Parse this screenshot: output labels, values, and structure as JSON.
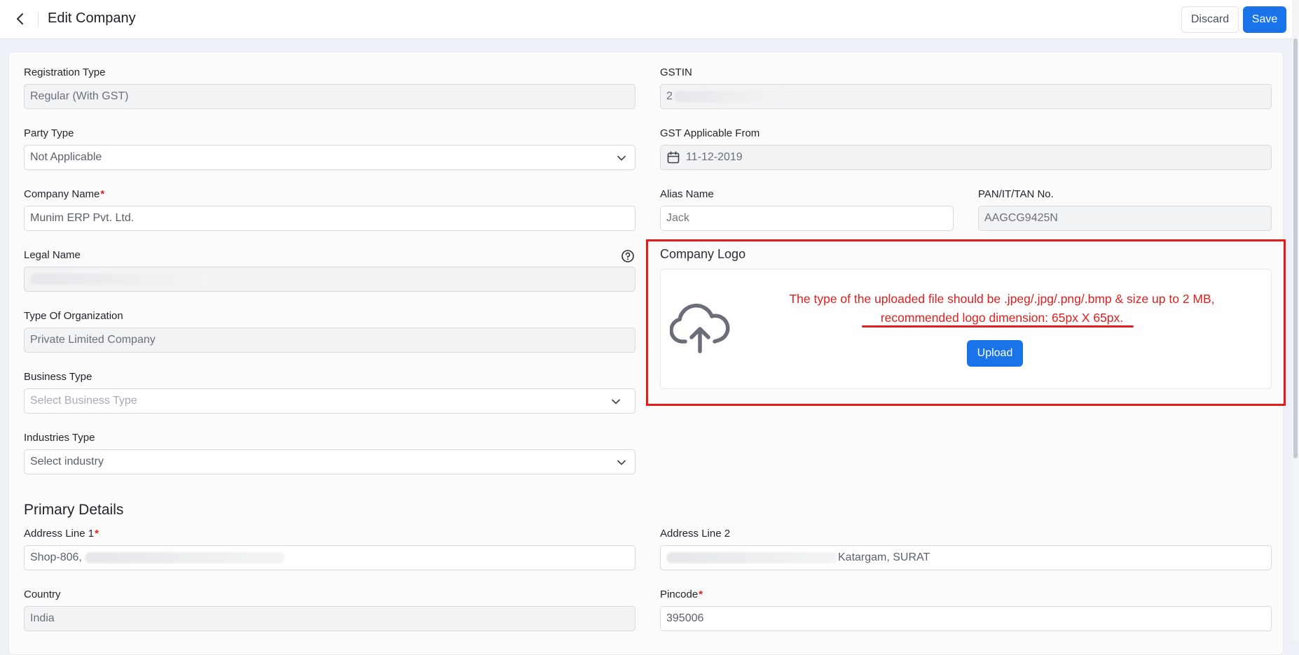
{
  "header": {
    "title": "Edit Company",
    "discard_label": "Discard",
    "save_label": "Save"
  },
  "form": {
    "registration_type": {
      "label": "Registration Type",
      "value": "Regular (With GST)"
    },
    "gstin": {
      "label": "GSTIN",
      "value": "2"
    },
    "party_type": {
      "label": "Party Type",
      "value": "Not Applicable"
    },
    "gst_applicable_from": {
      "label": "GST Applicable From",
      "value": "11-12-2019"
    },
    "company_name": {
      "label": "Company Name",
      "required": "*",
      "value": "Munim ERP Pvt. Ltd."
    },
    "alias_name": {
      "label": "Alias Name",
      "placeholder": "Jack"
    },
    "pan": {
      "label": "PAN/IT/TAN No.",
      "value": "AAGCG9425N"
    },
    "legal_name": {
      "label": "Legal Name"
    },
    "type_of_org": {
      "label": "Type Of Organization",
      "value": "Private Limited Company"
    },
    "business_type": {
      "label": "Business Type",
      "placeholder": "Select Business Type"
    },
    "industries_type": {
      "label": "Industries Type",
      "value": "Select industry"
    }
  },
  "company_logo": {
    "title": "Company Logo",
    "note_line1": "The type of the uploaded file should be .jpeg/.jpg/.png/.bmp & size up to 2 MB,",
    "note_line2": "recommended logo dimension: 65px X 65px.",
    "upload_label": "Upload",
    "accent_color": "#e01e1e"
  },
  "primary_details": {
    "title": "Primary Details",
    "address1": {
      "label": "Address Line 1",
      "required": "*",
      "value": "Shop-806,"
    },
    "address2": {
      "label": "Address Line 2",
      "value": "Katargam, SURAT"
    },
    "country": {
      "label": "Country",
      "value": "India"
    },
    "pincode": {
      "label": "Pincode",
      "required": "*",
      "value": "395006"
    }
  },
  "icons": [
    "back-arrow-icon",
    "chevron-down-icon",
    "calendar-icon",
    "help-circle-icon",
    "cloud-upload-icon"
  ],
  "colors": {
    "primary": "#1a73e8",
    "required": "#e01e1e"
  }
}
